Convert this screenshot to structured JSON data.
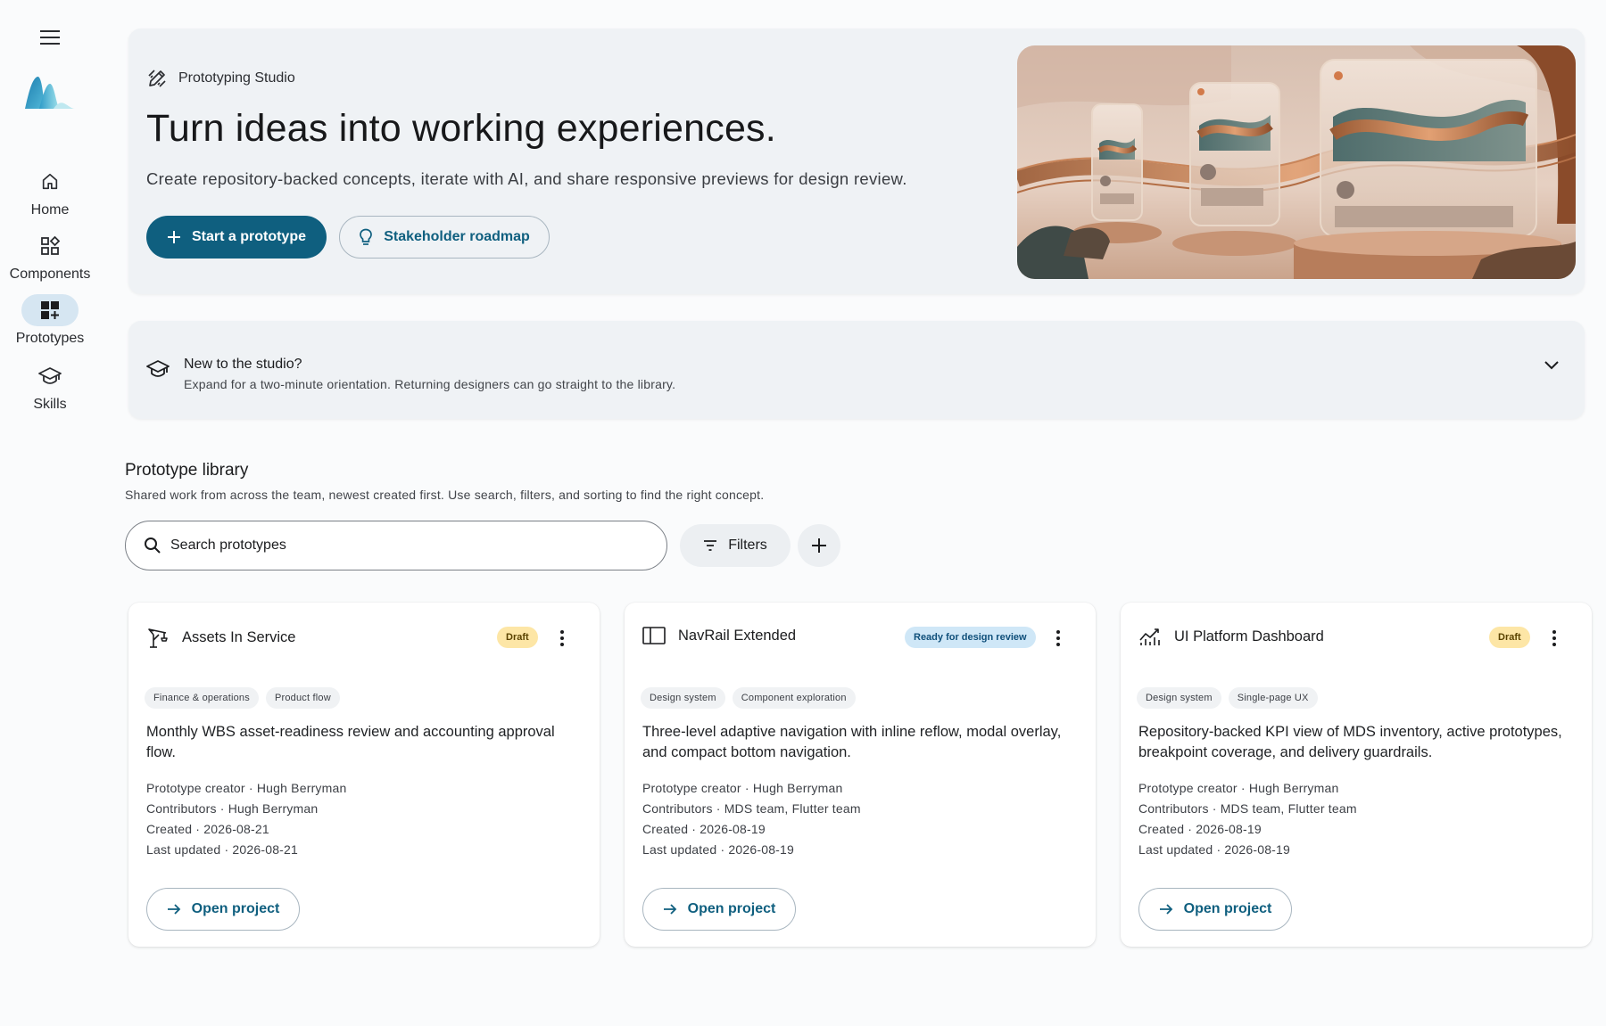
{
  "nav": {
    "menu_icon": "menu-icon",
    "items": [
      {
        "label": "Home",
        "icon": "home-icon",
        "active": false
      },
      {
        "label": "Components",
        "icon": "components-icon",
        "active": false
      },
      {
        "label": "Prototypes",
        "icon": "prototypes-icon",
        "active": true
      },
      {
        "label": "Skills",
        "icon": "skills-icon",
        "active": false
      }
    ]
  },
  "hero": {
    "eyebrow": "Prototyping Studio",
    "title": "Turn ideas into working experiences.",
    "subtitle": "Create repository-backed concepts, iterate with AI, and share responsive previews for design review.",
    "primary_button": "Start a prototype",
    "secondary_button": "Stakeholder roadmap"
  },
  "orientation": {
    "title": "New to the studio?",
    "subtitle": "Expand for a two-minute orientation. Returning designers can go straight to the library."
  },
  "library": {
    "title": "Prototype library",
    "subtitle": "Shared work from across the team, newest created first. Use search, filters, and sorting to find the right concept.",
    "search_placeholder": "Search prototypes",
    "filters_label": "Filters"
  },
  "cards": [
    {
      "title": "Assets In Service",
      "icon": "crane-icon",
      "status": "Draft",
      "tags": [
        "Finance & operations",
        "Product flow"
      ],
      "description": "Monthly WBS asset-readiness review and accounting approval flow.",
      "creator": "Prototype creator · Hugh Berryman",
      "contributors": "Contributors · Hugh Berryman",
      "created": "Created · 2026-08-21",
      "updated": "Last updated · 2026-08-21",
      "open_label": "Open project"
    },
    {
      "title": "NavRail Extended",
      "icon": "navrail-icon",
      "status": "Ready for design review",
      "tags": [
        "Design system",
        "Component exploration"
      ],
      "description": "Three-level adaptive navigation with inline reflow, modal overlay, and compact bottom navigation.",
      "creator": "Prototype creator · Hugh Berryman",
      "contributors": "Contributors · MDS team, Flutter team",
      "created": "Created · 2026-08-19",
      "updated": "Last updated · 2026-08-19",
      "open_label": "Open project"
    },
    {
      "title": "UI Platform Dashboard",
      "icon": "analytics-icon",
      "status": "Draft",
      "tags": [
        "Design system",
        "Single-page UX"
      ],
      "description": "Repository-backed KPI view of MDS inventory, active prototypes, breakpoint coverage, and delivery guardrails.",
      "creator": "Prototype creator · Hugh Berryman",
      "contributors": "Contributors · MDS team, Flutter team",
      "created": "Created · 2026-08-19",
      "updated": "Last updated · 2026-08-19",
      "open_label": "Open project"
    }
  ],
  "colors": {
    "primary": "#0f5f7f",
    "rail_active": "#d6e6f2",
    "surface": "#eff2f5",
    "draft_badge": "#fde6a6",
    "ready_badge": "#cfe7f7"
  }
}
